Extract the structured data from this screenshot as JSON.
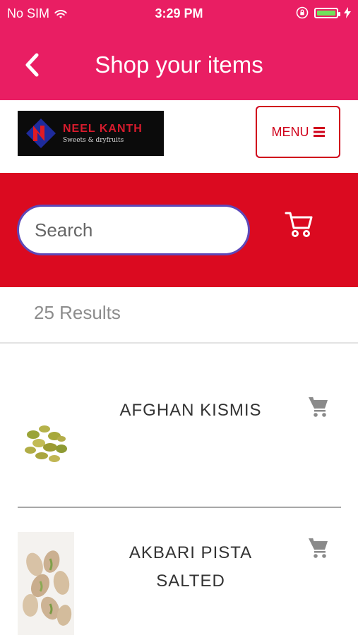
{
  "status": {
    "carrier": "No SIM",
    "time": "3:29 PM"
  },
  "nav": {
    "title": "Shop your items"
  },
  "logo": {
    "brand": "NEEL KANTH",
    "tagline": "Sweets & dryfruits"
  },
  "menu": {
    "label": "MENU"
  },
  "search": {
    "placeholder": "Search"
  },
  "results": {
    "text": "25 Results"
  },
  "items": [
    {
      "name": "AFGHAN KISMIS"
    },
    {
      "name": "AKBARI PISTA\nSALTED"
    }
  ],
  "colors": {
    "header_pink": "#e91e63",
    "search_bar_red": "#db0a20",
    "menu_red": "#d0011b",
    "search_border": "#5e48b8"
  }
}
